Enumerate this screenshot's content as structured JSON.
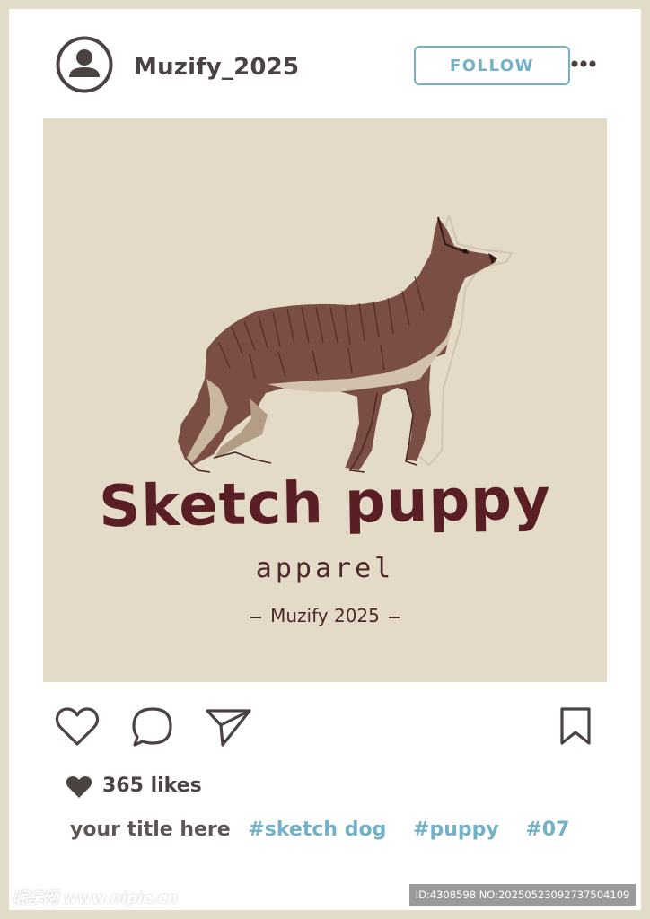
{
  "header": {
    "username": "Muzify_2025",
    "follow_label": "FOLLOW",
    "avatar_icon": "user-avatar-icon",
    "more_icon": "more-dots-icon"
  },
  "post": {
    "image_title": "Sketch puppy",
    "image_subtitle": "apparel",
    "image_credit": "Muzify 2025",
    "image_subject": "german-shepherd-sketch"
  },
  "actions": {
    "like_icon": "heart-outline-icon",
    "comment_icon": "comment-bubble-icon",
    "share_icon": "send-plane-icon",
    "save_icon": "bookmark-icon"
  },
  "likes": {
    "text": "365 likes",
    "icon": "heart-filled-icon"
  },
  "caption": {
    "title": "your title here",
    "tags": [
      "#sketch dog",
      "#puppy",
      "#07"
    ]
  },
  "watermark": {
    "left": "昵享网 www.nipic.cn",
    "right": "ID:4308598 NO:20250523092737504109"
  },
  "colors": {
    "background": "#e4dccb",
    "card": "#ffffff",
    "image_bg": "#e3dac8",
    "accent": "#73b1c7",
    "text_dark": "#4a4341",
    "brand_red": "#5a1f24"
  }
}
